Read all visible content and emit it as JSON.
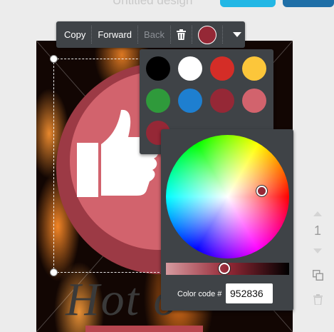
{
  "header": {
    "title": "Untitled design"
  },
  "toolbar": {
    "copy_label": "Copy",
    "forward_label": "Forward",
    "back_label": "Back",
    "delete_icon": "trash-icon",
    "current_color": "#952836",
    "dropdown_icon": "caret-down-icon"
  },
  "palette": {
    "swatches": [
      "#000000",
      "#ffffff",
      "#d42d27",
      "#fcc63a",
      "#2f9a3b",
      "#1e7fd0",
      "#952836",
      "#d2636d",
      "#952836"
    ]
  },
  "color_picker": {
    "color_code_label": "Color code #",
    "color_code_value": "952836"
  },
  "design": {
    "headline": "Hot o"
  },
  "page_nav": {
    "page_number": "1"
  },
  "colors": {
    "panel_bg": "#3f4347",
    "badge_outer": "#9c3a45",
    "badge_inner": "#d2636d"
  }
}
